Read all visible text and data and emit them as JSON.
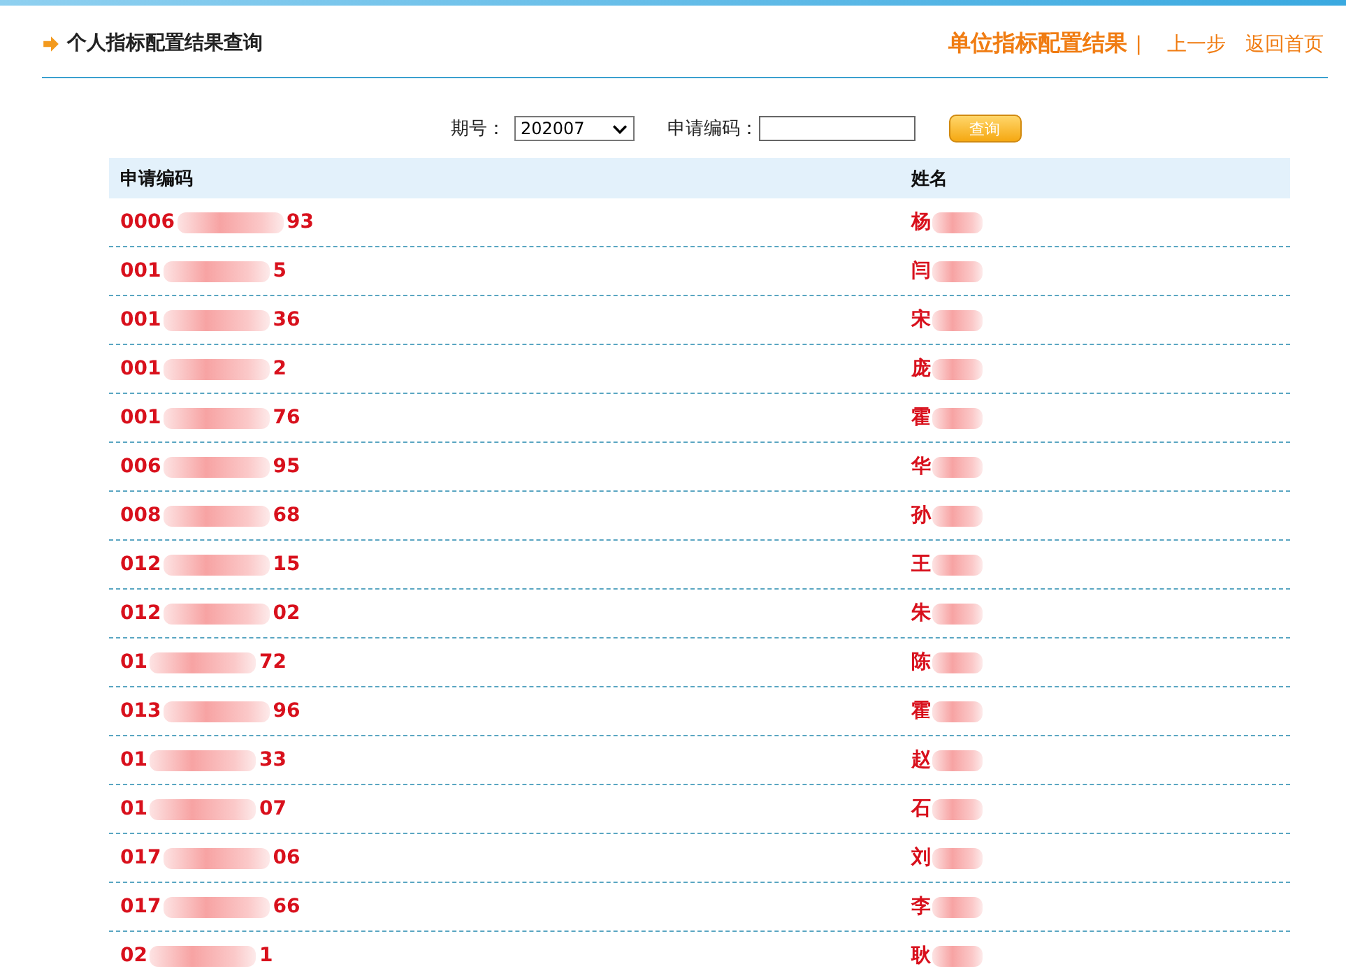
{
  "header": {
    "title": "个人指标配置结果查询",
    "links": [
      {
        "label": "单位指标配置结果",
        "kind": "heading"
      },
      {
        "label": "|",
        "kind": "separator"
      },
      {
        "label": "上一步",
        "kind": "link"
      },
      {
        "label": "返回首页",
        "kind": "link"
      }
    ]
  },
  "search": {
    "period_label": "期号：",
    "period_value": "202007",
    "code_label": "申请编码：",
    "button": "查询"
  },
  "table": {
    "columns": [
      "申请编码",
      "姓名"
    ],
    "rows": [
      {
        "code": [
          "0006",
          "93"
        ],
        "name": "杨"
      },
      {
        "code": [
          "001",
          "5"
        ],
        "name": "闫"
      },
      {
        "code": [
          "001",
          "36"
        ],
        "name": "宋"
      },
      {
        "code": [
          "001",
          "2"
        ],
        "name": "庞"
      },
      {
        "code": [
          "001",
          "76"
        ],
        "name": "霍"
      },
      {
        "code": [
          "006",
          "95"
        ],
        "name": "华"
      },
      {
        "code": [
          "008",
          "68"
        ],
        "name": "孙"
      },
      {
        "code": [
          "012",
          "15"
        ],
        "name": "王"
      },
      {
        "code": [
          "012",
          "02"
        ],
        "name": "朱"
      },
      {
        "code": [
          "01",
          "72"
        ],
        "name": "陈"
      },
      {
        "code": [
          "013",
          "96"
        ],
        "name": "霍"
      },
      {
        "code": [
          "01",
          "33"
        ],
        "name": "赵"
      },
      {
        "code": [
          "01",
          "07"
        ],
        "name": "石"
      },
      {
        "code": [
          "017",
          "06"
        ],
        "name": "刘"
      },
      {
        "code": [
          "017",
          "66"
        ],
        "name": "李"
      },
      {
        "code": [
          "02",
          "1"
        ],
        "name": "耿"
      }
    ]
  }
}
